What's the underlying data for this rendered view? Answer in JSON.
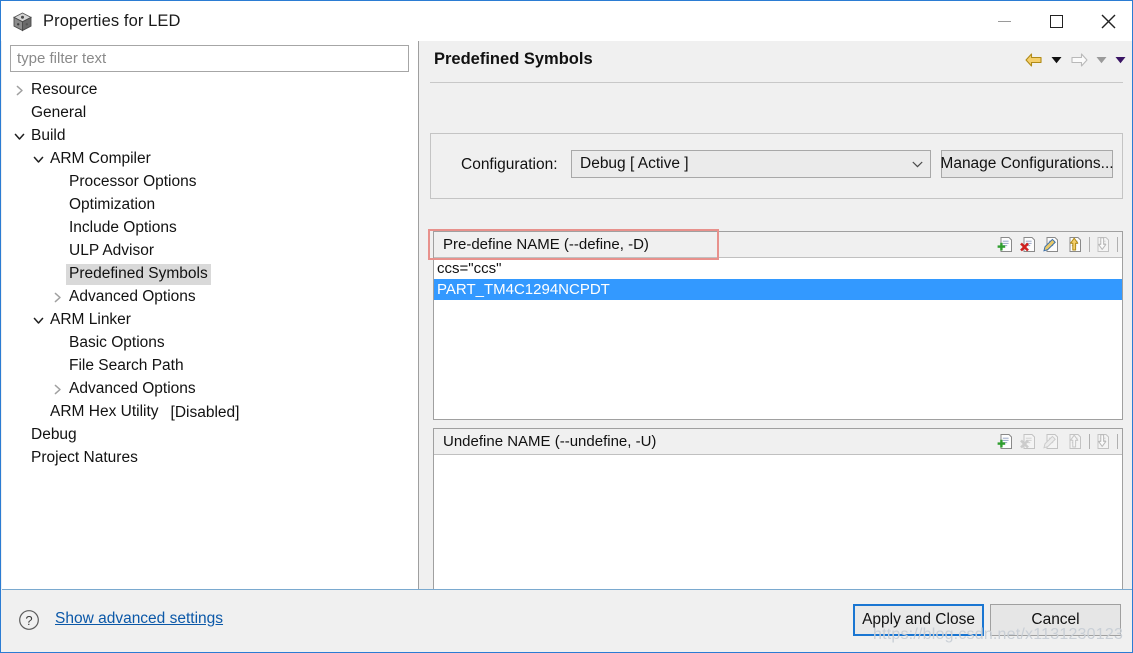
{
  "window": {
    "title": "Properties for LED",
    "icon": "cube-icon",
    "minimize_label": "Minimize",
    "maximize_label": "Maximize",
    "close_label": "Close"
  },
  "sidebar": {
    "filter": {
      "placeholder": "type filter text",
      "value": ""
    },
    "items": [
      {
        "label": "Resource",
        "depth": 0,
        "twisty": "collapsed",
        "selected": false
      },
      {
        "label": "General",
        "depth": 0,
        "twisty": "none",
        "selected": false
      },
      {
        "label": "Build",
        "depth": 0,
        "twisty": "expanded",
        "selected": false
      },
      {
        "label": "ARM Compiler",
        "depth": 1,
        "twisty": "expanded",
        "selected": false
      },
      {
        "label": "Processor Options",
        "depth": 2,
        "twisty": "none",
        "selected": false
      },
      {
        "label": "Optimization",
        "depth": 2,
        "twisty": "none",
        "selected": false
      },
      {
        "label": "Include Options",
        "depth": 2,
        "twisty": "none",
        "selected": false
      },
      {
        "label": "ULP Advisor",
        "depth": 2,
        "twisty": "none",
        "selected": false
      },
      {
        "label": "Predefined Symbols",
        "depth": 2,
        "twisty": "none",
        "selected": true
      },
      {
        "label": "Advanced Options",
        "depth": 2,
        "twisty": "collapsed",
        "selected": false
      },
      {
        "label": "ARM Linker",
        "depth": 1,
        "twisty": "expanded",
        "selected": false
      },
      {
        "label": "Basic Options",
        "depth": 2,
        "twisty": "none",
        "selected": false
      },
      {
        "label": "File Search Path",
        "depth": 2,
        "twisty": "none",
        "selected": false
      },
      {
        "label": "Advanced Options",
        "depth": 2,
        "twisty": "collapsed",
        "selected": false
      },
      {
        "label": "ARM Hex Utility",
        "depth": 1,
        "twisty": "none",
        "selected": false,
        "suffix": "[Disabled]"
      },
      {
        "label": "Debug",
        "depth": 0,
        "twisty": "none",
        "selected": false
      },
      {
        "label": "Project Natures",
        "depth": 0,
        "twisty": "none",
        "selected": false
      }
    ]
  },
  "page": {
    "title": "Predefined Symbols",
    "nav": {
      "back_label": "Back",
      "back_menu_label": "Back history",
      "forward_label": "Forward",
      "forward_menu_label": "Forward history",
      "view_menu_label": "View menu"
    }
  },
  "configuration": {
    "label": "Configuration:",
    "value": "Debug  [ Active ]",
    "options": [
      "Debug  [ Active ]"
    ],
    "manage_label": "Manage Configurations..."
  },
  "predefine_group": {
    "title": "Pre-define NAME (--define, -D)",
    "tools": [
      {
        "name": "add-icon",
        "enabled": true
      },
      {
        "name": "delete-icon",
        "enabled": true
      },
      {
        "name": "edit-icon",
        "enabled": true
      },
      {
        "name": "move-up-icon",
        "enabled": true
      },
      {
        "name": "move-down-icon",
        "enabled": false
      }
    ],
    "rows": [
      {
        "value": "ccs=\"ccs\"",
        "selected": false
      },
      {
        "value": "PART_TM4C1294NCPDT",
        "selected": true
      }
    ]
  },
  "undefine_group": {
    "title": "Undefine NAME (--undefine, -U)",
    "tools": [
      {
        "name": "add-icon",
        "enabled": true
      },
      {
        "name": "delete-icon",
        "enabled": false
      },
      {
        "name": "edit-icon",
        "enabled": false
      },
      {
        "name": "move-up-icon",
        "enabled": false
      },
      {
        "name": "move-down-icon",
        "enabled": false
      }
    ],
    "rows": []
  },
  "footer": {
    "help_icon": "help-icon",
    "advanced_link": "Show advanced settings",
    "apply_label": "Apply and Close",
    "cancel_label": "Cancel"
  },
  "watermark": "https://blog.csdn.net/x1131230123",
  "colors": {
    "selection_blue": "#3399ff",
    "annotation_red": "#e8918c",
    "focus_blue": "#1a76d2",
    "link_blue": "#0b58a8",
    "window_border": "#2b7cd3"
  }
}
